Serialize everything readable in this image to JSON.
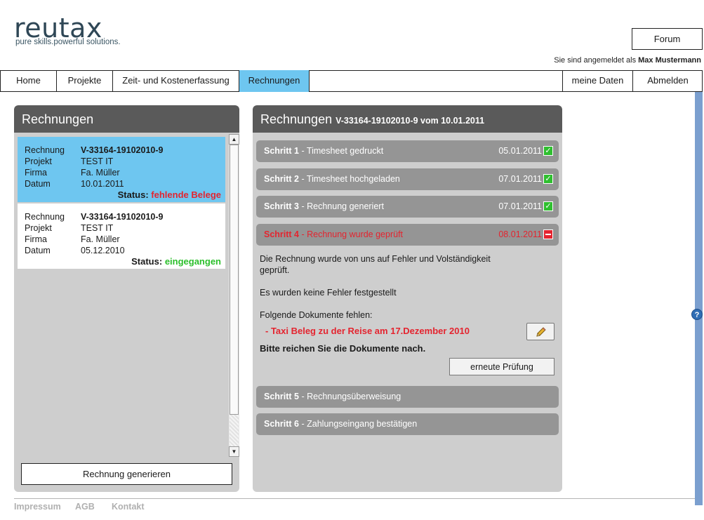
{
  "brand": {
    "name": "reutax",
    "tagline": "pure skills.powerful solutions."
  },
  "header": {
    "forum_label": "Forum",
    "login_prefix": "Sie sind angemeldet als",
    "login_user": "Max Mustermann"
  },
  "nav": {
    "home": "Home",
    "projects": "Projekte",
    "time": "Zeit- und Kostenerfassung",
    "invoices": "Rechnungen",
    "my_data": "meine Daten",
    "logout": "Abmelden"
  },
  "left_panel": {
    "title": "Rechnungen",
    "labels": {
      "invoice": "Rechnung",
      "project": "Projekt",
      "company": "Firma",
      "date": "Datum",
      "status": "Status:"
    },
    "invoices": [
      {
        "number": "V-33164-19102010-9",
        "project": "TEST IT",
        "company": "Fa. Müller",
        "date": "10.01.2011",
        "status": "fehlende Belege"
      },
      {
        "number": "V-33164-19102010-9",
        "project": "TEST IT",
        "company": "Fa. Müller",
        "date": "05.12.2010",
        "status": "eingegangen"
      }
    ],
    "generate_label": "Rechnung generieren"
  },
  "right_panel": {
    "title": "Rechnungen",
    "subtitle": "V-33164-19102010-9 vom 10.01.2011",
    "steps": [
      {
        "label": "Schritt 1",
        "text": " - Timesheet gedruckt",
        "date": "05.01.2011",
        "state": "done"
      },
      {
        "label": "Schritt 2",
        "text": " - Timesheet hochgeladen",
        "date": "07.01.2011",
        "state": "done"
      },
      {
        "label": "Schritt 3",
        "text": " - Rechnung generiert",
        "date": "07.01.2011",
        "state": "done"
      },
      {
        "label": "Schritt 4",
        "text": " - Rechnung wurde geprüft",
        "date": "08.01.2011",
        "state": "error"
      },
      {
        "label": "Schritt 5",
        "text": " - Rechnungsüberweisung",
        "date": "",
        "state": "pending"
      },
      {
        "label": "Schritt 6",
        "text": " - Zahlungseingang bestätigen",
        "date": "",
        "state": "pending"
      }
    ],
    "detail": {
      "line1": "Die Rechnung wurde von uns auf Fehler und Volständigkeit",
      "line2": "geprüft.",
      "no_errors": "Es wurden keine Fehler festgestellt",
      "missing_heading": "Folgende Dokumente fehlen:",
      "missing_item": "- Taxi Beleg zu der Reise am 17.Dezember 2010",
      "request": "Bitte reichen Sie die Dokumente nach.",
      "recheck_label": "erneute Prüfung"
    }
  },
  "footer": {
    "impressum": "Impressum",
    "agb": "AGB",
    "contact": "Kontakt"
  },
  "colors": {
    "accent": "#6ec6f0",
    "error": "#e4242f",
    "success": "#2bbf2b",
    "panel": "#cecece",
    "header": "#5a5a5a"
  }
}
